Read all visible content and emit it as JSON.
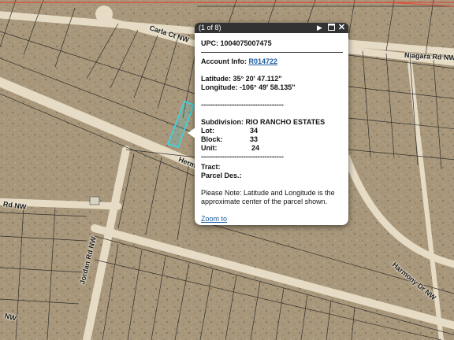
{
  "map": {
    "road_labels": [
      "Carla Ct NW",
      "Niagara Rd NW",
      "Herm",
      "Rd NW",
      "Jordan Rd NW",
      "Harmony Dr NW",
      "NW"
    ],
    "colors": {
      "terrain": "#a8977a",
      "road": "#ede3cf",
      "parcel_line": "#2f2f2f",
      "selected_parcel": "#39d8e8",
      "boundary_line": "#e04a3a"
    }
  },
  "popup": {
    "counter": "(1 of 8)",
    "next_icon": "play-right-icon",
    "maximize_icon": "maximize-icon",
    "close_icon": "close-icon",
    "upc_line": "UPC: 1004075007475",
    "account_label": "Account Info: ",
    "account_link": "R014722",
    "latitude": "Latitude: 35° 20' 47.112\"",
    "longitude": "Longitude: -106° 49' 58.135\"",
    "separator1": "-----------------------------------",
    "subdivision": "Subdivision: RIO RANCHO ESTATES",
    "lot_label": "Lot:",
    "lot_value": "34",
    "block_label": "Block:",
    "block_value": "33",
    "unit_label": "Unit:",
    "unit_value": "24",
    "separator2": "-----------------------------------",
    "tract": "Tract:",
    "parcel_des": "Parcel Des.:",
    "note": "Please Note: Latitude and Longitude is the approximate center of the parcel shown.",
    "zoom_link": "Zoom to"
  }
}
